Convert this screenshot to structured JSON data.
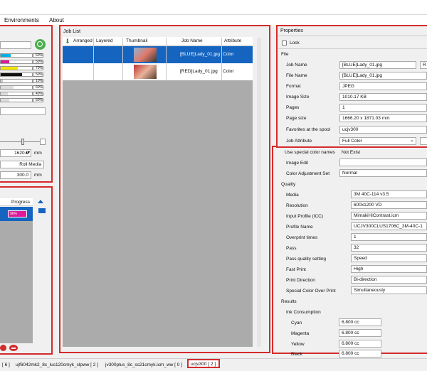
{
  "menu": [
    "Environments",
    "About"
  ],
  "left_panel": {
    "ink_levels": [
      "60%",
      "50%",
      "70%",
      "50%",
      "10%",
      "60%",
      "40%",
      "50%"
    ],
    "width_value": "1620.0",
    "width_unit": "mm",
    "roll_media_label": "Roll Media",
    "length_value": "300.0",
    "length_unit": "mm",
    "progress_header": "Progress",
    "progress_value": "96%"
  },
  "job_list": {
    "title": "Job List",
    "columns": [
      "Arranged",
      "Layered",
      "Thumbnail",
      "Job Name",
      "Attribute"
    ],
    "rows": [
      {
        "job_name": "[BLUE]Lady_01.jpg",
        "attribute": "Color",
        "selected": true
      },
      {
        "job_name": "[RED]Lady_01.jpg",
        "attribute": "Color",
        "selected": false
      }
    ]
  },
  "properties": {
    "tab": "Properties",
    "lock_label": "Lock",
    "file_section": "File",
    "file_fields": [
      {
        "label": "Job Name",
        "value": "[BLUE]Lady_01.jpg"
      },
      {
        "label": "File Name",
        "value": "[BLUE]Lady_01.jpg"
      },
      {
        "label": "Format",
        "value": "JPEG"
      },
      {
        "label": "Image Size",
        "value": "1010.17 KB"
      },
      {
        "label": "Pages",
        "value": "1"
      },
      {
        "label": "Page size",
        "value": "1666.20 x 1871.03 mm"
      },
      {
        "label": "Favorites at the spool",
        "value": "ucjv300"
      },
      {
        "label": "Job Attribute",
        "value": "Full Color"
      }
    ],
    "button_r": "R",
    "general_fields": [
      {
        "label": "Use special color names",
        "value": "Not Exist"
      },
      {
        "label": "Image Edit",
        "value": ""
      },
      {
        "label": "Color Adjustment Set",
        "value": "Normal"
      }
    ],
    "quality_section": "Quality",
    "quality_fields": [
      {
        "label": "Media",
        "value": "3M 40C-114 v3.5"
      },
      {
        "label": "Resolution",
        "value": "600x1200 VD"
      },
      {
        "label": "Input Profile (ICC)",
        "value": "MimakiHiContrast.icm"
      },
      {
        "label": "Profile Name",
        "value": "UCJV300CLUS1706C_3M-40C-1"
      },
      {
        "label": "Overprint times",
        "value": "1"
      },
      {
        "label": "Pass",
        "value": "32"
      },
      {
        "label": "Pass quality setting",
        "value": "Speed"
      },
      {
        "label": "Fast Print",
        "value": "High"
      },
      {
        "label": "Print Direction",
        "value": "Bi-direction"
      },
      {
        "label": "Special Color Over Print",
        "value": "Simultaneously"
      }
    ],
    "results_section": "Results",
    "ink_consumption_label": "Ink Consumption",
    "ink": [
      {
        "label": "Cyan",
        "value": "6.800 cc"
      },
      {
        "label": "Magenta",
        "value": "6.800 cc"
      },
      {
        "label": "Yellow",
        "value": "6.800 cc"
      },
      {
        "label": "Black",
        "value": "6.800 cc"
      }
    ]
  },
  "status_tabs": [
    "[ 6 ]",
    "ujf6042mk2_8c_lus120cmyk_clpww [ 2 ]",
    "jv300plus_8c_ss21cmyk.icm_ww [ 0 ]",
    "ucjv300 [ 2 ]"
  ],
  "colors": {
    "highlight": "#1565c0",
    "accent_red": "#d42b2b",
    "cyan": "#00b0e8",
    "magenta": "#e0199a",
    "yellow": "#f5e400",
    "black": "#111111"
  }
}
